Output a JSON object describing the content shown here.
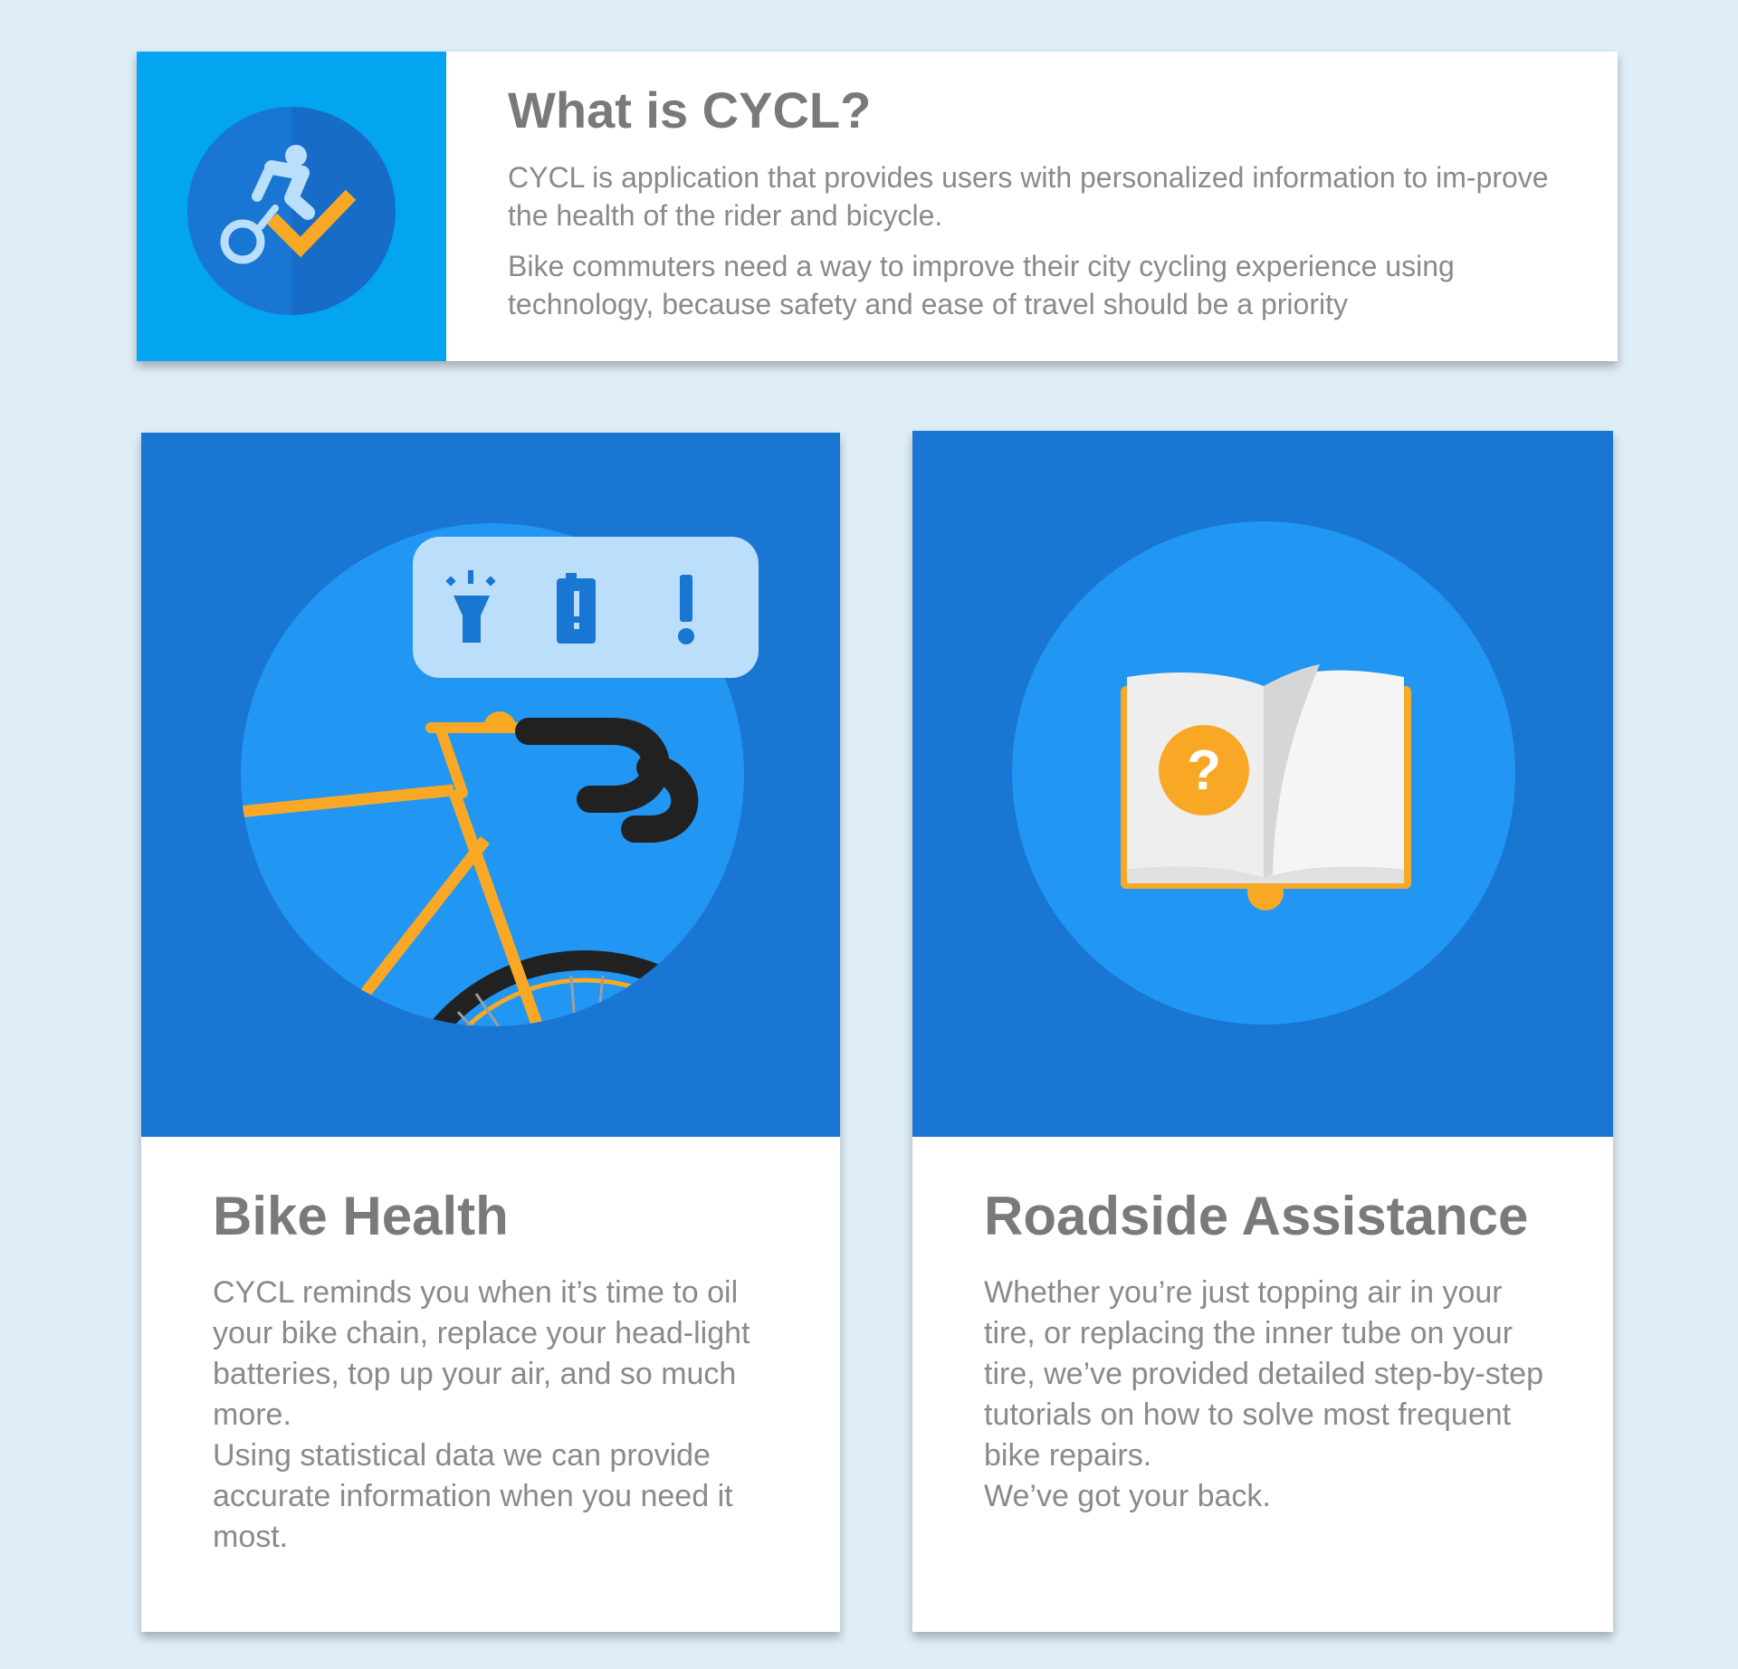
{
  "intro": {
    "title": "What is CYCL?",
    "paragraph_1": "CYCL is application that provides users with personalized information to im-prove the health of the rider and bicycle.",
    "paragraph_2": "Bike commuters need a way to improve their city cycling experience using technology, because safety and ease of travel should be a priority",
    "icon": "cyclist-checkmark-icon"
  },
  "features": [
    {
      "title": "Bike Health",
      "text": "CYCL reminds you when it’s time to oil your bike chain, replace your head-light batteries, top up your air, and so much more.\nUsing statistical data we can provide accurate information when you need it most.",
      "icons": [
        "flashlight-icon",
        "battery-alert-icon",
        "exclamation-icon",
        "bicycle-illustration"
      ]
    },
    {
      "title": "Roadside Assistance",
      "text": "Whether you’re just topping air in your tire, or replacing the inner tube on your tire, we’ve provided detailed step-by-step tutorials on how to solve most frequent bike repairs.\nWe’ve got your back.",
      "icons": [
        "help-book-icon"
      ]
    }
  ],
  "colors": {
    "page_background": "#dfedf7",
    "intro_accent": "#03a5f1",
    "card_art_background": "#1976d2",
    "circle_background": "#2196f3",
    "bike_frame": "#f9a825",
    "heading_text": "#7a7a7a",
    "body_text": "#8a8a8a"
  }
}
